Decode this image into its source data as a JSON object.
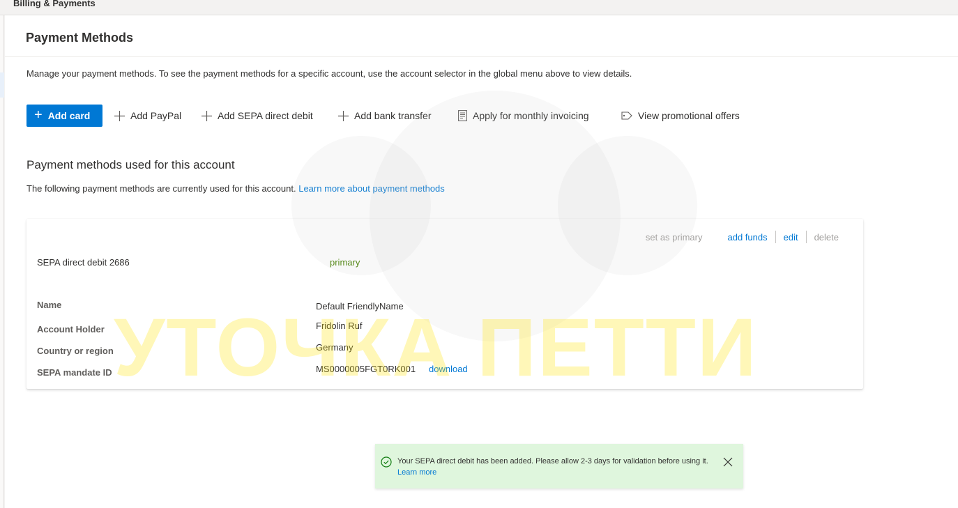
{
  "topbar": {
    "title": "Billing & Payments"
  },
  "page": {
    "title": "Payment Methods",
    "description": "Manage your payment methods. To see the payment methods for a specific account, use the account selector in the global menu above to view details."
  },
  "toolbar": {
    "add_card": "Add card",
    "add_paypal": "Add PayPal",
    "add_sepa": "Add SEPA direct debit",
    "add_bank_transfer": "Add bank transfer",
    "apply_invoicing": "Apply for monthly invoicing",
    "view_offers": "View promotional offers"
  },
  "section": {
    "title": "Payment methods used for this account",
    "description": "The following payment methods are currently used for this account.",
    "learn_more": "Learn more about payment methods"
  },
  "card": {
    "name": "SEPA direct debit 2686",
    "status": "primary",
    "actions": {
      "set_primary": "set as primary",
      "add_funds": "add funds",
      "edit": "edit",
      "delete": "delete"
    },
    "details": {
      "name_label": "Name",
      "name_value": "Default FriendlyName",
      "holder_label": "Account Holder",
      "holder_value": "Fridolin Ruf",
      "country_label": "Country or region",
      "country_value": "Germany",
      "mandate_label": "SEPA mandate ID",
      "mandate_value": "MS0000005FGT0RK001",
      "download": "download"
    }
  },
  "toast": {
    "message": "Your SEPA direct debit has been added. Please allow 2-3 days for validation before using it.",
    "learn_more": "Learn more"
  },
  "watermark": {
    "text": "УТОЧКА ПЕТТИ"
  },
  "colors": {
    "accent": "#0078d4",
    "success_bg": "#dff6dd",
    "success_icon": "#107c10",
    "primary_status": "#498205"
  }
}
